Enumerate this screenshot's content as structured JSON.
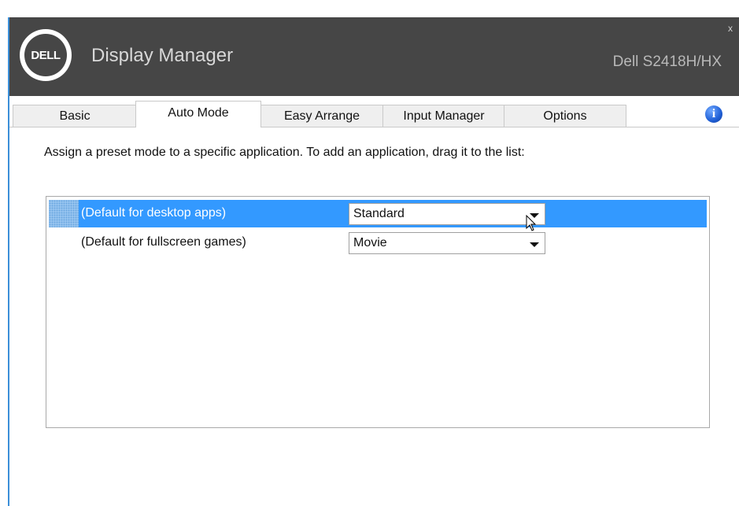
{
  "window": {
    "app_title": "Display Manager",
    "model": "Dell S2418H/HX",
    "close_label": "x",
    "logo_text": "DELL"
  },
  "tabs": [
    {
      "label": "Basic",
      "active": false
    },
    {
      "label": "Auto Mode",
      "active": true
    },
    {
      "label": "Easy Arrange",
      "active": false
    },
    {
      "label": "Input Manager",
      "active": false
    },
    {
      "label": "Options",
      "active": false
    }
  ],
  "info_icon": "i",
  "instruction": "Assign a preset mode to a specific application.  To add an application, drag it to the list:",
  "rows": [
    {
      "label": "(Default for desktop apps)",
      "mode": "Standard",
      "selected": true
    },
    {
      "label": "(Default for fullscreen games)",
      "mode": "Movie",
      "selected": false
    }
  ],
  "colors": {
    "titlebar": "#464646",
    "selection": "#3399ff",
    "window_border": "#3c8fd8"
  }
}
